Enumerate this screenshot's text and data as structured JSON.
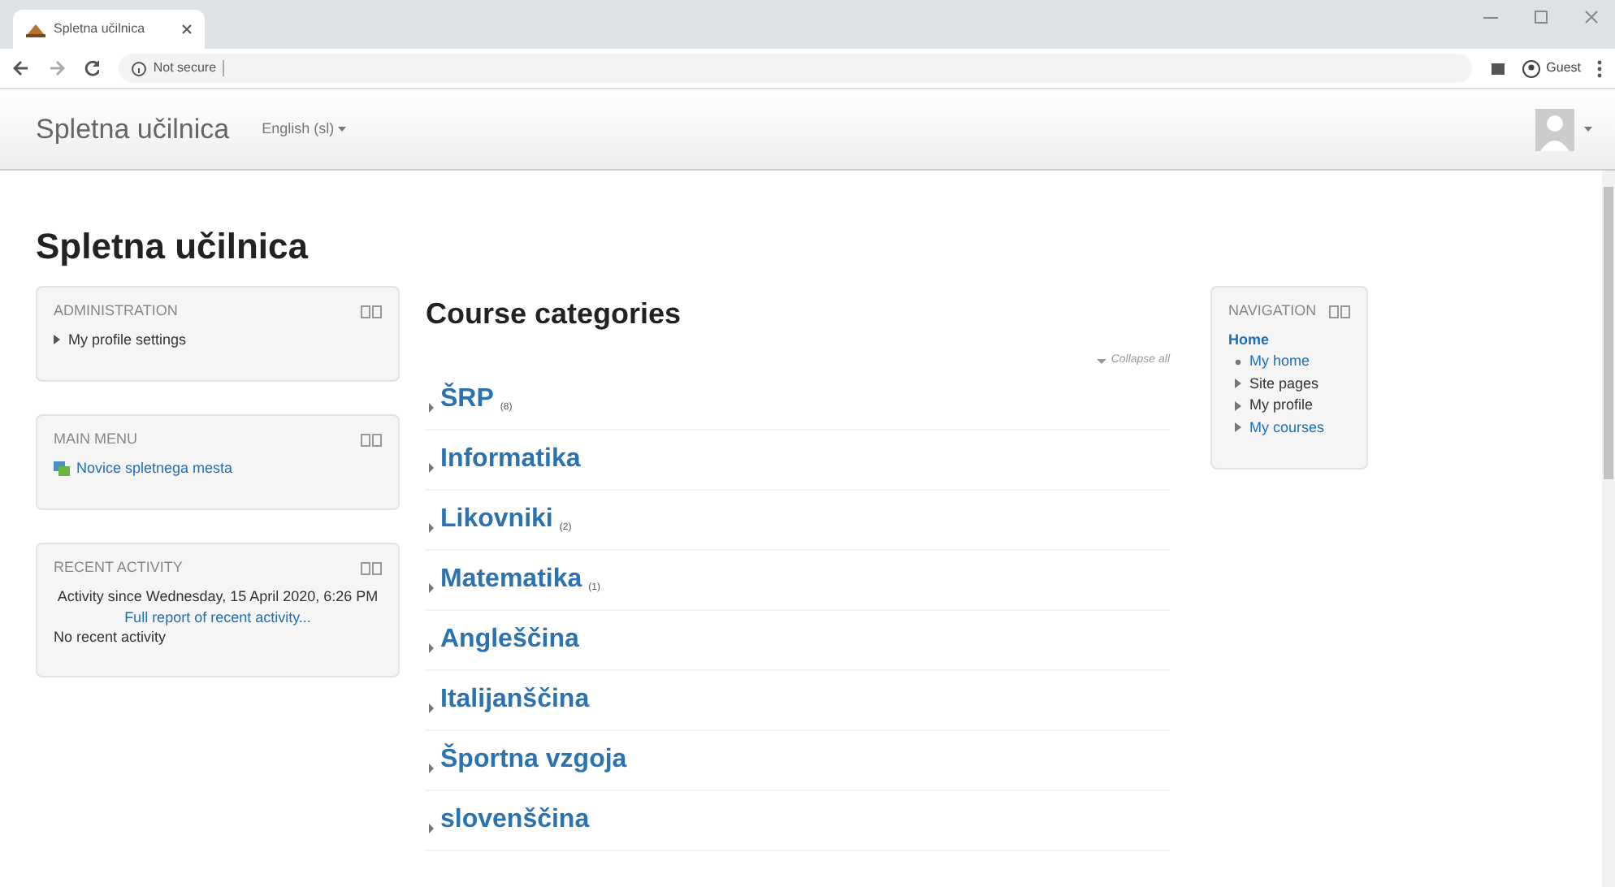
{
  "browser": {
    "tab_title": "Spletna učilnica",
    "security": "Not secure",
    "profile": "Guest"
  },
  "navbar": {
    "brand": "Spletna učilnica",
    "language": "English (sl)"
  },
  "page_title": "Spletna učilnica",
  "left_blocks": [
    {
      "title": "ADMINISTRATION",
      "kind": "tree",
      "items": [
        "My profile settings"
      ]
    },
    {
      "title": "MAIN MENU",
      "kind": "links",
      "items": [
        "Novice spletnega mesta"
      ]
    },
    {
      "title": "RECENT ACTIVITY",
      "kind": "activity",
      "since": "Activity since Wednesday, 15 April 2020, 6:26 PM",
      "report_link": "Full report of recent activity...",
      "empty": "No recent activity"
    }
  ],
  "main": {
    "heading": "Course categories",
    "collapse_all": "Collapse all",
    "categories": [
      {
        "name": "ŠRP",
        "count": "(8)"
      },
      {
        "name": "Informatika"
      },
      {
        "name": "Likovniki",
        "count": "(2)"
      },
      {
        "name": "Matematika",
        "count": "(1)"
      },
      {
        "name": "Angleščina"
      },
      {
        "name": "Italijanščina"
      },
      {
        "name": "Športna vzgoja"
      },
      {
        "name": "slovenščina"
      }
    ]
  },
  "navigation": {
    "title": "NAVIGATION",
    "home": "Home",
    "children": [
      {
        "label": "My home",
        "kind": "leaf",
        "link": true
      },
      {
        "label": "Site pages",
        "kind": "branch",
        "link": false
      },
      {
        "label": "My profile",
        "kind": "branch",
        "link": false
      },
      {
        "label": "My courses",
        "kind": "branch",
        "link": true
      }
    ]
  }
}
